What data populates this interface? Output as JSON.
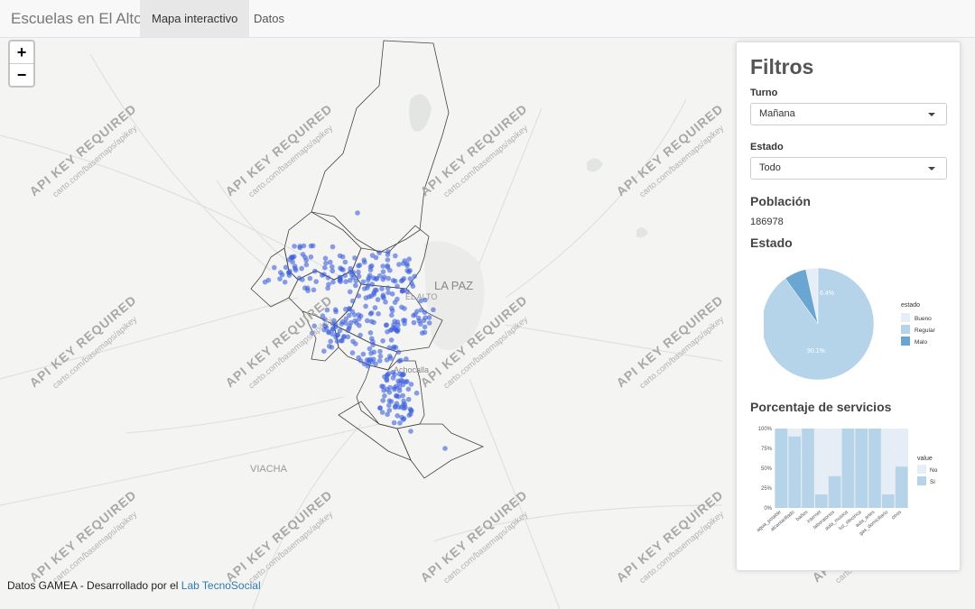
{
  "navbar": {
    "brand": "Escuelas en El Alto",
    "tabs": [
      {
        "label": "Mapa interactivo",
        "active": true
      },
      {
        "label": "Datos",
        "active": false
      }
    ]
  },
  "map": {
    "zoom_in": "+",
    "zoom_out": "−",
    "place_labels": {
      "la_paz": "LA PAZ",
      "el_alto": "EL ALTO",
      "achocalla": "Achocalla",
      "viacha": "VIACHA"
    },
    "watermark_title": "API KEY REQUIRED",
    "watermark_url": "carto.com/basemaps/apikey",
    "attribution_prefix": "Datos GAMEA - Desarrollado por el",
    "attribution_link": "Lab TecnoSocial",
    "point_color": "#3b5fe0"
  },
  "filters": {
    "title": "Filtros",
    "turno_label": "Turno",
    "turno_value": "Mañana",
    "estado_label": "Estado",
    "estado_value": "Todo",
    "poblacion_title": "Población",
    "poblacion_value": "186978",
    "estado_chart_title": "Estado",
    "servicios_title": "Porcentaje de servicios"
  },
  "chart_data": [
    {
      "type": "pie",
      "title": "Estado",
      "legend_title": "estado",
      "legend_position": "right",
      "slices": [
        {
          "name": "Bueno",
          "value": 3.5,
          "color": "#e5eef7"
        },
        {
          "name": "Regular",
          "value": 90.1,
          "color": "#b5d4e9"
        },
        {
          "name": "Malo",
          "value": 6.4,
          "color": "#6aa6d2"
        }
      ],
      "labels": [
        "6.4%",
        "90.1%"
      ]
    },
    {
      "type": "bar",
      "stacked": true,
      "legend_title": "value",
      "legend_position": "right",
      "categories": [
        "agua_potable",
        "alcantarillado",
        "baños",
        "internet",
        "laboratorios",
        "aula_musica",
        "luz_electrica",
        "aula_artes",
        "gas_domiciliario",
        "otros"
      ],
      "series": [
        {
          "name": "Si",
          "values": [
            100,
            90,
            100,
            17,
            40,
            100,
            100,
            100,
            17,
            52
          ],
          "color": "#b5d4e9"
        },
        {
          "name": "No",
          "values": [
            0,
            10,
            0,
            83,
            60,
            0,
            0,
            0,
            83,
            48
          ],
          "color": "#e5eef7"
        }
      ],
      "y_ticks": [
        "0%",
        "25%",
        "50%",
        "75%",
        "100%"
      ],
      "ylim": [
        0,
        100
      ]
    }
  ]
}
